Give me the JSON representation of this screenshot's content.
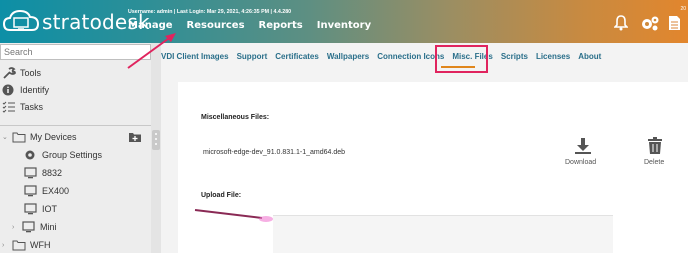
{
  "brand": {
    "name": "stratodesk"
  },
  "header": {
    "user_info": "Username: admin | Last Login: Mar 29, 2021, 4:26:35 PM |  4.4.280",
    "nav": [
      "Manage",
      "Resources",
      "Reports",
      "Inventory"
    ],
    "corner": "20"
  },
  "sidebar": {
    "search_placeholder": "Search",
    "tools": "Tools",
    "identify": "Identify",
    "tasks": "Tasks",
    "my_devices": "My Devices",
    "group_settings": "Group Settings",
    "devices": [
      "8832",
      "EX400",
      "IOT",
      "Mini"
    ],
    "wfh": "WFH"
  },
  "subnav": [
    "VDI Client Images",
    "Support",
    "Certificates",
    "Wallpapers",
    "Connection Icons",
    "Misc. Files",
    "Scripts",
    "Licenses",
    "About"
  ],
  "main": {
    "misc_label": "Miscellaneous Files:",
    "file_name": "microsoft-edge-dev_91.0.831.1-1_amd64.deb",
    "download": "Download",
    "delete": "Delete",
    "upload_label": "Upload File:"
  },
  "colors": {
    "accent": "#e0861b",
    "highlight": "#e0245e",
    "link": "#2a6f8a"
  }
}
